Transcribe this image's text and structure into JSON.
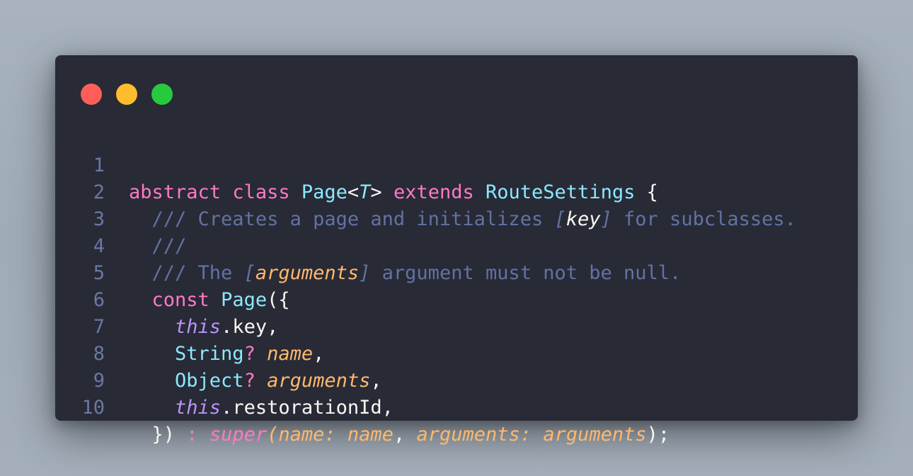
{
  "window": {
    "buttons": {
      "close_color": "#ff5f56",
      "minimize_color": "#ffbd2e",
      "maximize_color": "#27c93f"
    }
  },
  "code": {
    "line_numbers": [
      "1",
      "2",
      "3",
      "4",
      "5",
      "6",
      "7",
      "8",
      "9",
      "10"
    ],
    "l1": {
      "abstract": "abstract",
      "class": "class",
      "page": "Page",
      "lt": "<",
      "t": "T",
      "gt": ">",
      "extends": "extends",
      "route_settings": "RouteSettings",
      "brace": "{"
    },
    "l2": {
      "indent": "  ",
      "comment_a": "/// Creates a page and initializes ",
      "bracket_open": "[",
      "key": "key",
      "bracket_close": "]",
      "comment_b": " for subclasses."
    },
    "l3": {
      "indent": "  ",
      "comment": "///"
    },
    "l4": {
      "indent": "  ",
      "comment_a": "/// The ",
      "bracket_open": "[",
      "arguments": "arguments",
      "bracket_close": "]",
      "comment_b": " argument must not be null."
    },
    "l5": {
      "indent": "  ",
      "const": "const",
      "page": "Page",
      "open": "({"
    },
    "l6": {
      "indent": "    ",
      "this": "this",
      "rest": ".key,"
    },
    "l7": {
      "indent": "    ",
      "type": "String",
      "q": "?",
      "name": "name",
      "comma": ","
    },
    "l8": {
      "indent": "    ",
      "type": "Object",
      "q": "?",
      "name": "arguments",
      "comma": ","
    },
    "l9": {
      "indent": "    ",
      "this": "this",
      "rest": ".restorationId,"
    },
    "l10": {
      "indent": "  ",
      "close": "})",
      "colon": ":",
      "super": "super",
      "paren_open": "(",
      "name_label": "name:",
      "name_val": "name",
      "comma": ",",
      "args_label": "arguments:",
      "args_val": "arguments",
      "end": ");"
    }
  }
}
